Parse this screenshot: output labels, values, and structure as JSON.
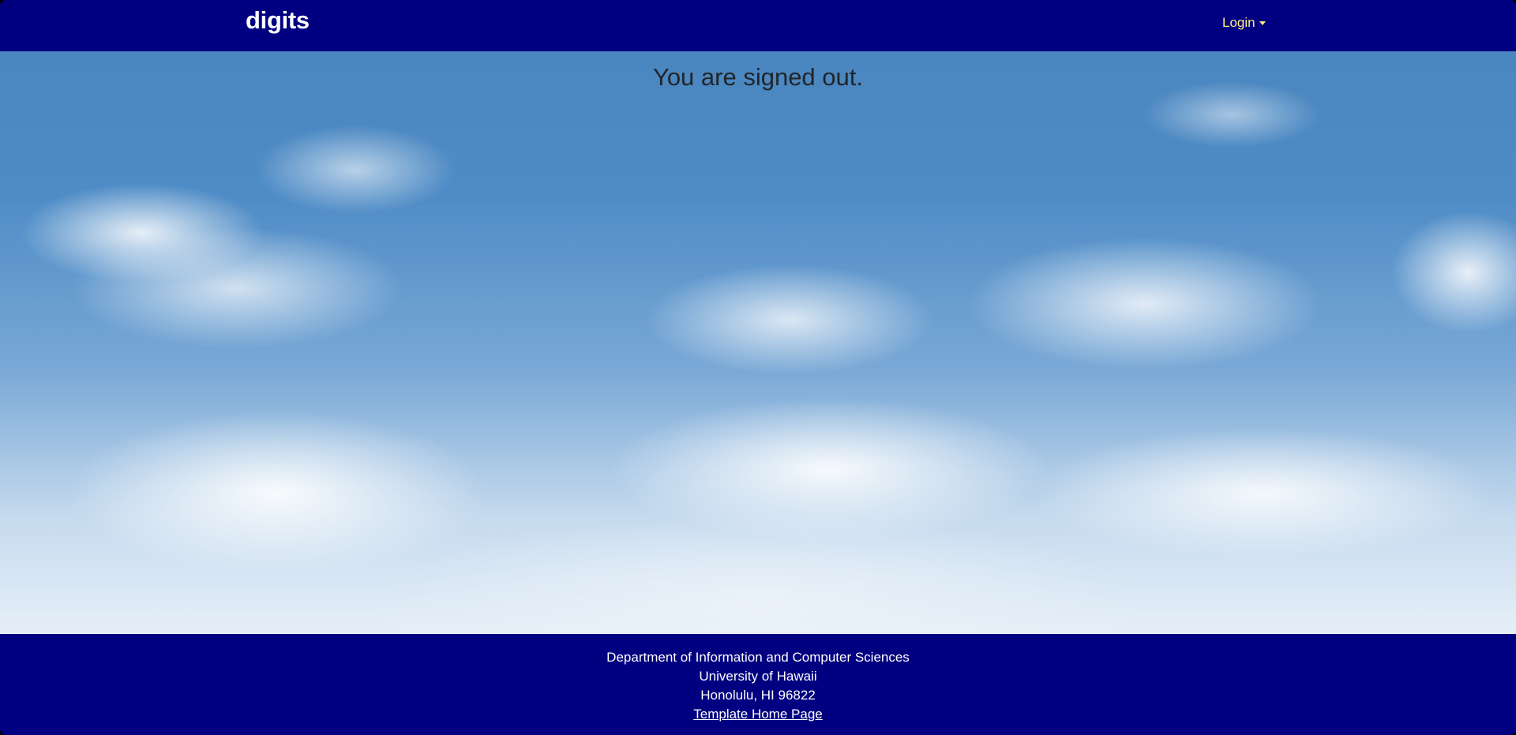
{
  "navbar": {
    "brand": "digits",
    "login_label": "Login"
  },
  "main": {
    "message": "You are signed out."
  },
  "footer": {
    "line1": "Department of Information and Computer Sciences",
    "line2": "University of Hawaii",
    "line3": "Honolulu, HI 96822",
    "link_label": "Template Home Page"
  },
  "colors": {
    "navbar_bg": "#000080",
    "footer_bg": "#000080",
    "login_accent": "#ffeb80",
    "text_dark": "#212529"
  },
  "icons": {
    "login_dropdown": "caret-down-icon"
  }
}
